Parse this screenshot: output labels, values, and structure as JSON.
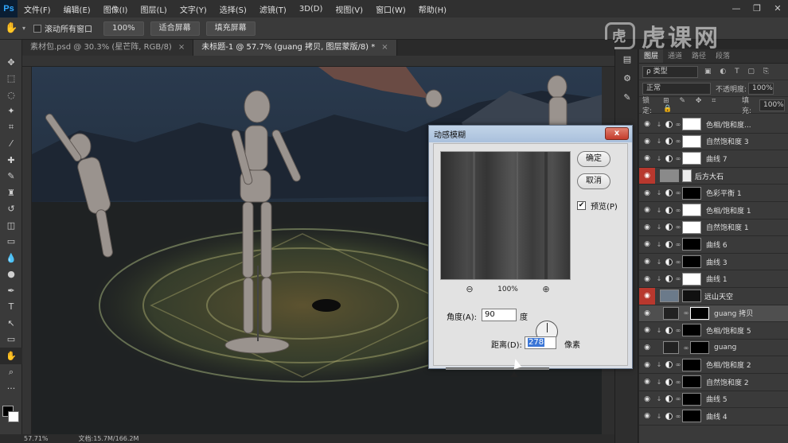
{
  "app": {
    "logo": "Ps"
  },
  "menu": [
    "文件(F)",
    "编辑(E)",
    "图像(I)",
    "图层(L)",
    "文字(Y)",
    "选择(S)",
    "滤镜(T)",
    "3D(D)",
    "视图(V)",
    "窗口(W)",
    "帮助(H)"
  ],
  "window_controls": {
    "minimize": "—",
    "restore": "❐",
    "close": "✕"
  },
  "options_bar": {
    "scroll_all_label": "滚动所有窗口",
    "zoom_value": "100%",
    "fit_screen": "适合屏幕",
    "fill_screen": "填充屏幕"
  },
  "watermark": {
    "logo": "虎",
    "text": "虎课网"
  },
  "tabs": [
    {
      "label": "素材包.psd @ 30.3% (星芒阵, RGB/8)",
      "close": "×",
      "active": false
    },
    {
      "label": "未标题-1 @ 57.7% (guang 拷贝, 图层蒙版/8) *",
      "close": "×",
      "active": true
    }
  ],
  "status": {
    "zoom": "57.71%",
    "doc": "文档:15.7M/166.2M"
  },
  "panel": {
    "tabs": [
      "图层",
      "通道",
      "路径",
      "段落"
    ],
    "kind_label": "ρ 类型",
    "blend_mode": "正常",
    "opacity_label": "不透明度:",
    "opacity_value": "100%",
    "lock_label": "锁定:",
    "fill_label": "填充:",
    "fill_value": "100%"
  },
  "layers": [
    {
      "name": "色相/饱和度...",
      "type": "adj",
      "mask": "white"
    },
    {
      "name": "自然饱和度 3",
      "type": "adj",
      "mask": "white"
    },
    {
      "name": "曲线 7",
      "type": "adj",
      "mask": "white"
    },
    {
      "name": "后方大石",
      "type": "group",
      "mask": "none"
    },
    {
      "name": "色彩平衡 1",
      "type": "adj",
      "mask": "dark"
    },
    {
      "name": "色相/饱和度 1",
      "type": "adj",
      "mask": "white"
    },
    {
      "name": "自然饱和度 1",
      "type": "adj",
      "mask": "white"
    },
    {
      "name": "曲线 6",
      "type": "adj",
      "mask": "dark"
    },
    {
      "name": "曲线 3",
      "type": "adj",
      "mask": "dark"
    },
    {
      "name": "曲线 1",
      "type": "adj",
      "mask": "white"
    },
    {
      "name": "远山天空",
      "type": "group",
      "mask": "none"
    },
    {
      "name": "guang 拷贝",
      "type": "pixel",
      "mask": "dark",
      "selected": true
    },
    {
      "name": "色相/饱和度 5",
      "type": "adj",
      "mask": "dark"
    },
    {
      "name": "guang",
      "type": "pixel",
      "mask": "dark"
    },
    {
      "name": "色相/饱和度 2",
      "type": "adj",
      "mask": "dark"
    },
    {
      "name": "自然饱和度 2",
      "type": "adj",
      "mask": "dark"
    },
    {
      "name": "曲线 5",
      "type": "adj",
      "mask": "dark"
    },
    {
      "name": "曲线 4",
      "type": "adj",
      "mask": "dark"
    }
  ],
  "dialog": {
    "title": "动感模糊",
    "close": "x",
    "ok": "确定",
    "cancel": "取消",
    "preview_label": "预览(P)",
    "preview_check": "✔",
    "zoom_level": "100%",
    "zoom_out": "⊖",
    "zoom_in": "⊕",
    "angle_label": "角度(A):",
    "angle_value": "90",
    "angle_unit": "度",
    "distance_label": "距离(D):",
    "distance_value": "278",
    "distance_unit": "像素"
  },
  "icons": {
    "hand": "✋",
    "move": "✥",
    "marquee": "⬚",
    "lasso": "◌",
    "wand": "✦",
    "crop": "⌗",
    "eyedropper": "⁄",
    "heal": "✚",
    "brush": "✎",
    "stamp": "♜",
    "history": "↺",
    "eraser": "◫",
    "gradient": "▭",
    "blur": "💧",
    "dodge": "●",
    "pen": "✒",
    "type": "T",
    "path": "↖",
    "shape": "▭",
    "zoom": "⌕",
    "more": "···"
  }
}
